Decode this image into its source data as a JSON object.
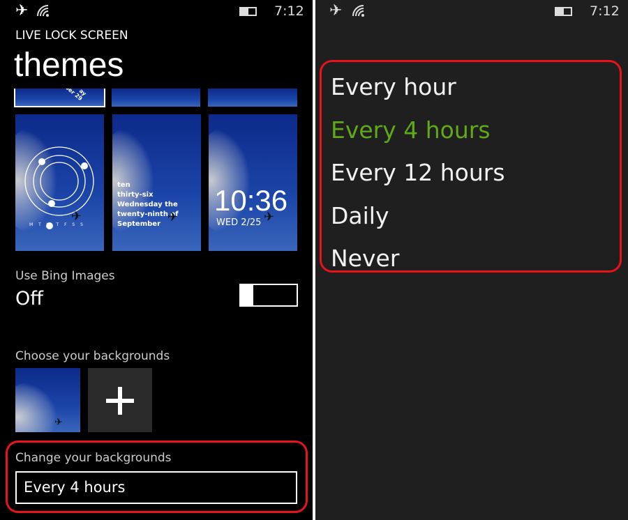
{
  "status": {
    "time": "7:12",
    "icons": [
      "airplane-icon",
      "wifi-icon",
      "battery-icon"
    ]
  },
  "header": {
    "app_title": "LIVE LOCK SCREEN",
    "page_title": "themes"
  },
  "themes": {
    "tile1_text": [
      "ten",
      "thirty-six",
      "Wednesday the",
      "twenty-ninth of",
      "September"
    ],
    "tile2_days": "M T W T F S S",
    "tile3_time": "10:36",
    "tile3_date": "WED 2/25",
    "partial_text": "ay\nber 29"
  },
  "bing": {
    "label": "Use Bing Images",
    "value": "Off",
    "enabled": false
  },
  "backgrounds": {
    "label": "Choose your backgrounds",
    "add_icon": "plus-icon"
  },
  "change": {
    "label": "Change your backgrounds",
    "value": "Every 4 hours"
  },
  "picker": {
    "options": [
      "Every hour",
      "Every 4 hours",
      "Every 12 hours",
      "Daily",
      "Never"
    ],
    "selected_index": 1
  },
  "colors": {
    "accent": "#60a917",
    "highlight": "#e8141c",
    "right_bg": "#1f1f1f"
  }
}
